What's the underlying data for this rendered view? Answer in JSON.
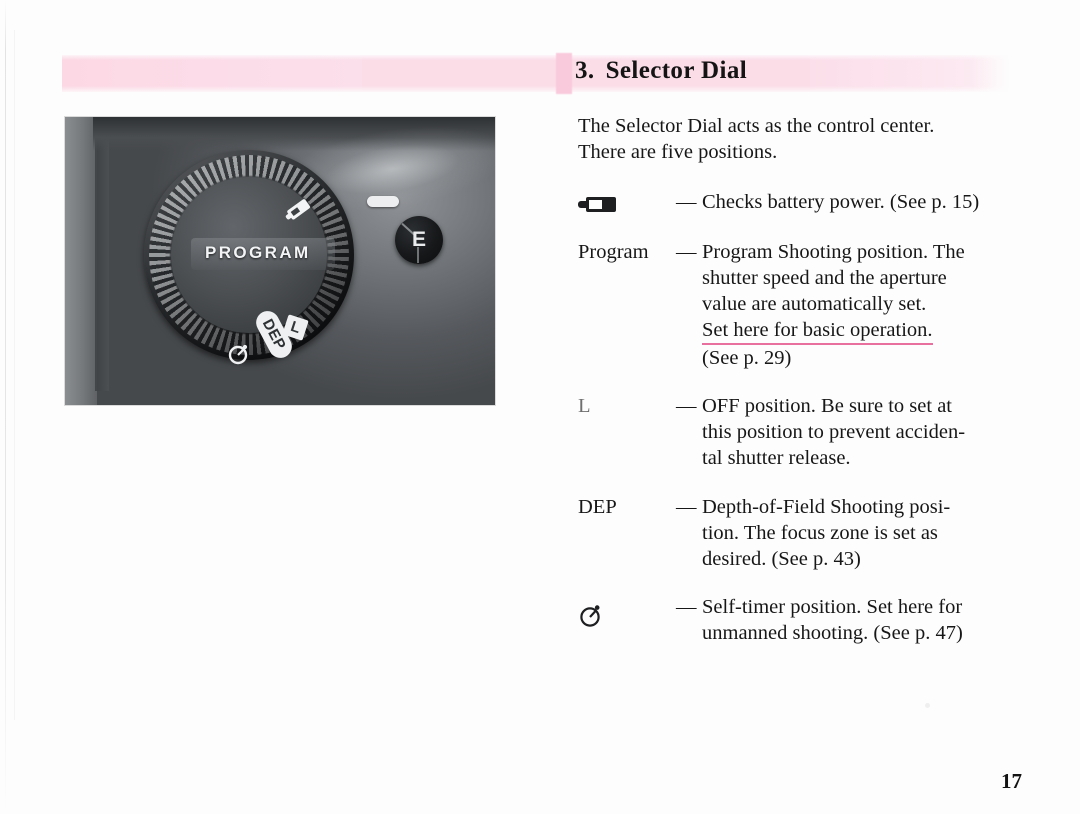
{
  "page": {
    "number": "17",
    "background_color": "#fdfdfd"
  },
  "header": {
    "number": "3.",
    "title": "Selector Dial",
    "band_color": "#fbdde8",
    "marker_color": "#f9c9dc"
  },
  "photo": {
    "caption_alt": "Camera top plate showing the selector dial",
    "dial_label_program": "PROGRAM",
    "dial_label_l": "L",
    "dial_label_dep": "DEP",
    "dial_icon_battery": "battery-icon",
    "dial_icon_selftimer": "self-timer-icon",
    "index_mark": "index-mark",
    "button_e": "E"
  },
  "intro": {
    "line1": "The Selector Dial acts as the control center.",
    "line2": "There are five positions."
  },
  "entries": [
    {
      "term": "",
      "term_icon": "battery-icon",
      "dash": "—",
      "lines": [
        "Checks battery power. (See p. 15)"
      ],
      "underline_index": -1
    },
    {
      "term": "Program",
      "term_icon": "",
      "dash": "—",
      "lines": [
        "Program Shooting position. The",
        "shutter speed and the aperture",
        "value are automatically set.",
        "Set here for basic operation.",
        "(See p. 29)"
      ],
      "underline_index": 3,
      "underline_color": "#e8709e"
    },
    {
      "term": "L",
      "term_icon": "",
      "dash": "—",
      "lines": [
        "OFF position. Be sure to set at",
        "this position to prevent acciden-",
        "tal shutter release."
      ],
      "underline_index": -1
    },
    {
      "term": "DEP",
      "term_icon": "",
      "dash": "—",
      "lines": [
        "Depth-of-Field Shooting posi-",
        "tion. The focus zone is set as",
        "desired. (See p. 43)"
      ],
      "underline_index": -1
    },
    {
      "term": "",
      "term_icon": "self-timer-icon",
      "dash": "—",
      "lines": [
        "Self-timer position. Set here for",
        "unmanned shooting. (See p. 47)"
      ],
      "underline_index": -1
    }
  ]
}
